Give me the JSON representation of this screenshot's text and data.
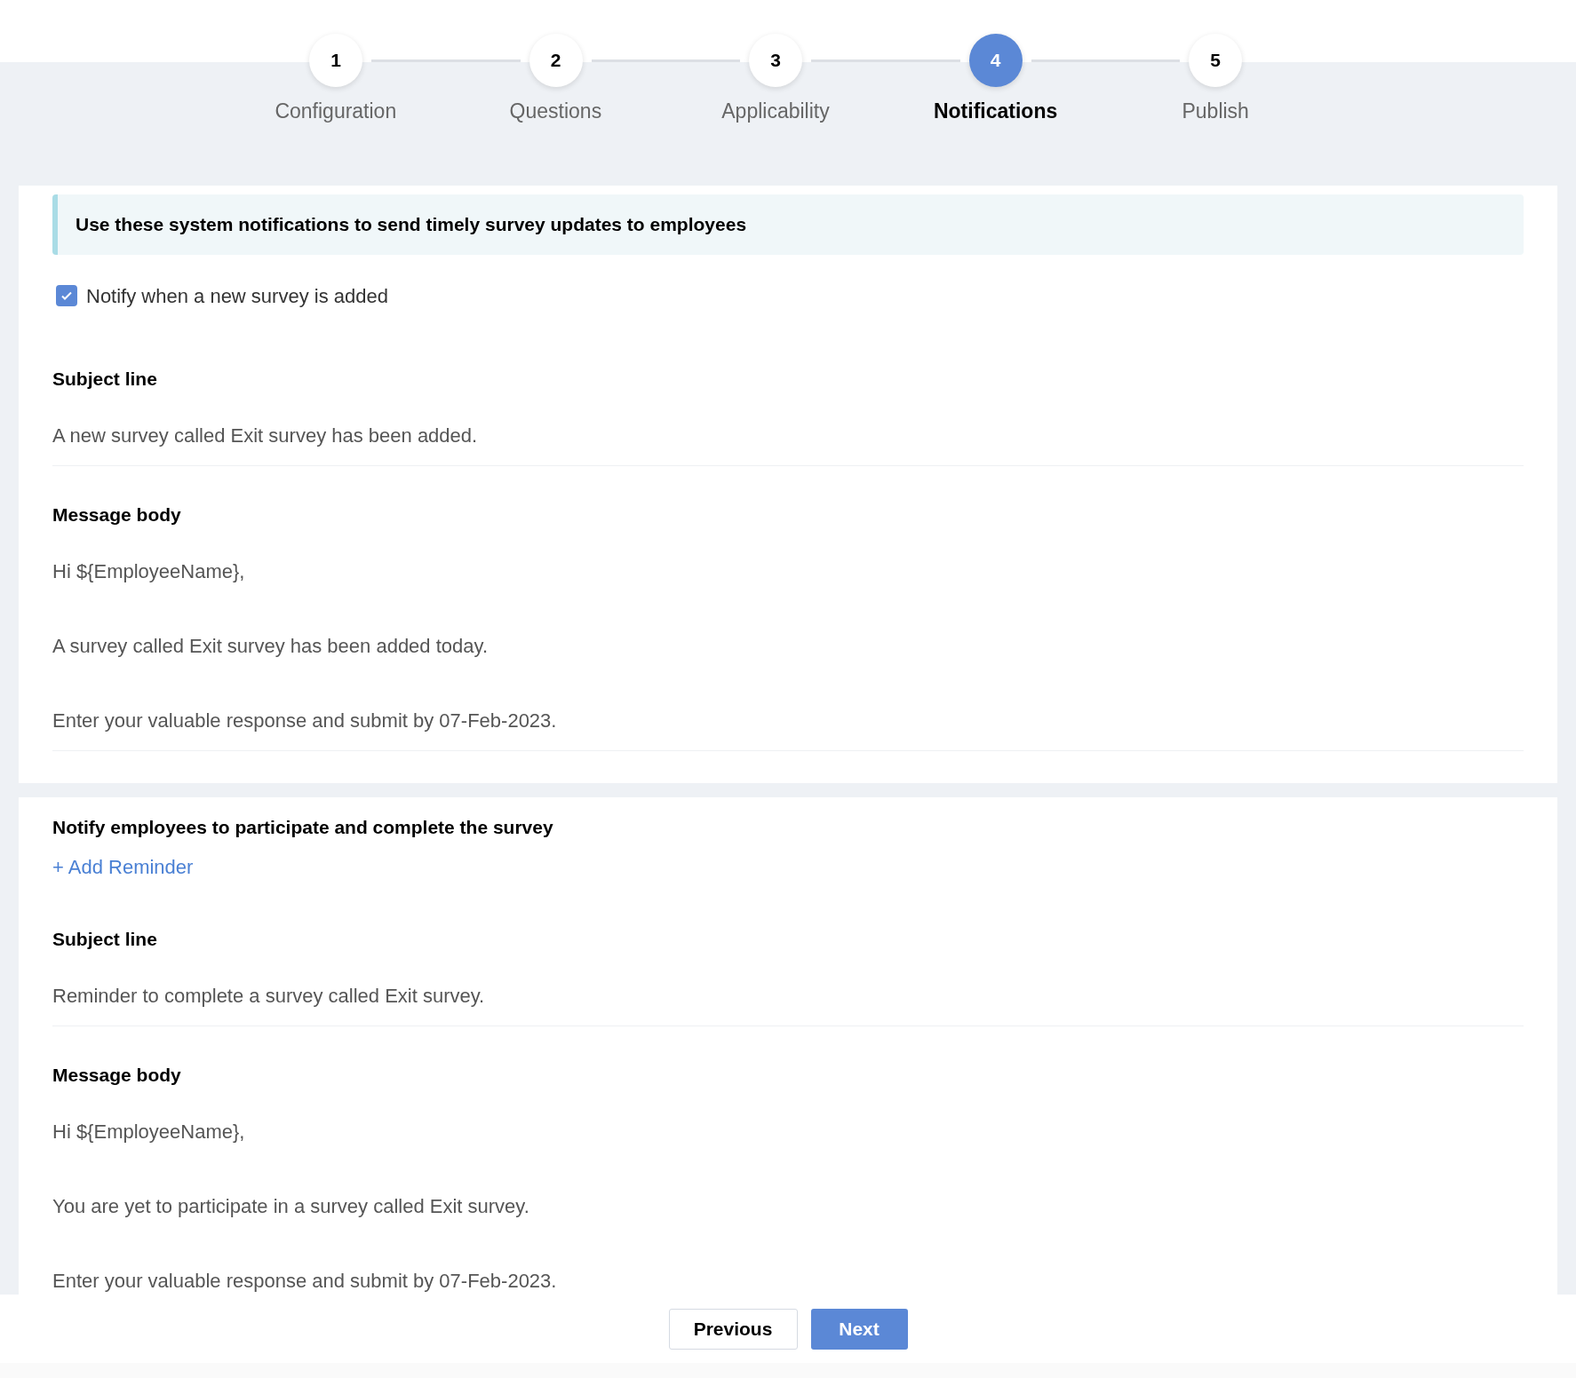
{
  "steps": [
    {
      "number": "1",
      "label": "Configuration",
      "selected": false
    },
    {
      "number": "2",
      "label": "Questions",
      "selected": false
    },
    {
      "number": "3",
      "label": "Applicability",
      "selected": false
    },
    {
      "number": "4",
      "label": "Notifications",
      "selected": true
    },
    {
      "number": "5",
      "label": "Publish",
      "selected": false
    }
  ],
  "banner": "Use these system notifications to send timely survey updates to employees",
  "new_survey": {
    "checkbox": {
      "label": "Notify when a new survey is added",
      "checked": true
    },
    "subject_label": "Subject line",
    "subject": "A new survey called Exit survey has been added.",
    "body_label": "Message body",
    "body_lines": [
      "Hi ${EmployeeName},",
      "A survey called Exit survey has been added today.",
      "Enter your valuable response and submit by 07-Feb-2023."
    ]
  },
  "reminder": {
    "heading": "Notify employees to participate and complete the survey",
    "add_link": "+ Add Reminder",
    "subject_label": "Subject line",
    "subject": "Reminder to complete a survey called Exit survey.",
    "body_label": "Message body",
    "body_lines": [
      "Hi ${EmployeeName},",
      "You are yet to participate in a survey called Exit survey.",
      "Enter your valuable response and submit by 07-Feb-2023."
    ]
  },
  "buttons": {
    "previous": "Previous",
    "next": "Next"
  }
}
